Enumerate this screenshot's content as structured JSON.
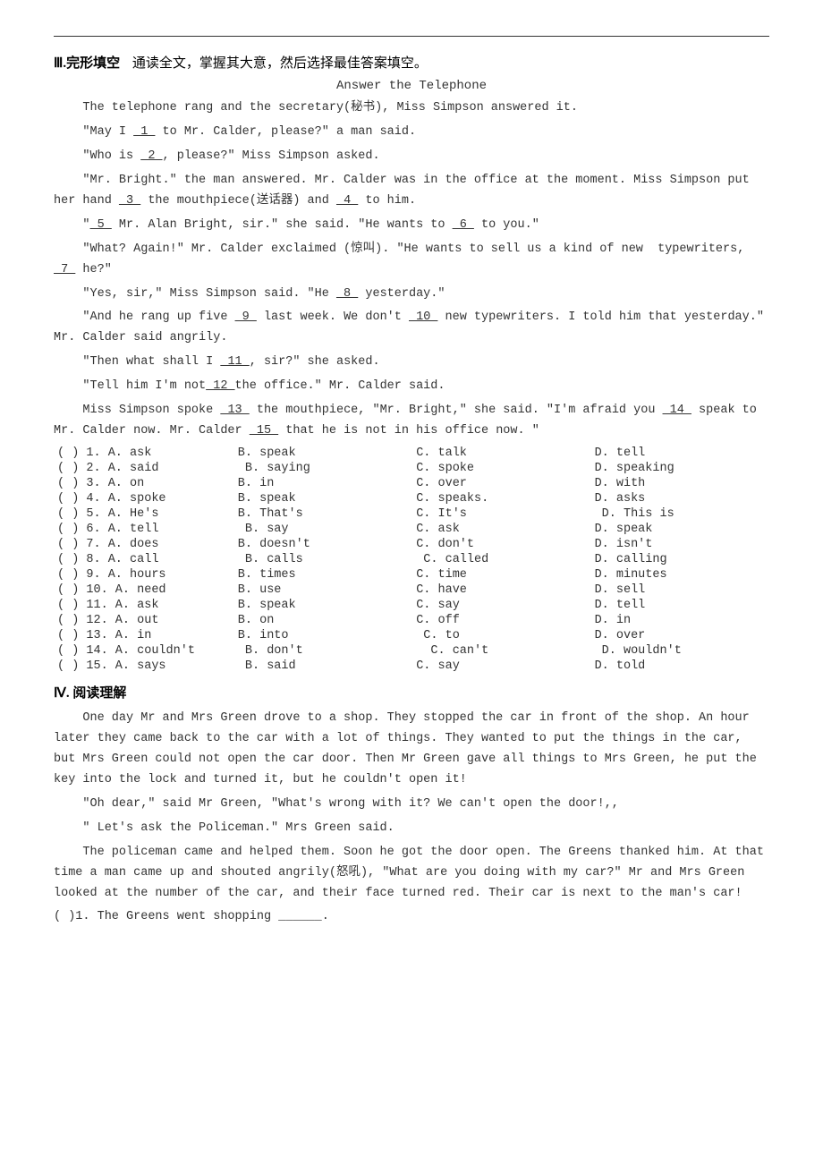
{
  "topBorder": true,
  "section3": {
    "header": "Ⅲ.完形填空",
    "instruction": "通读全文，掌握其大意，然后选择最佳答案填空。",
    "title": "Answer the Telephone",
    "passage": [
      "The telephone rang and the secretary(秘书), Miss Simpson answered it.",
      "\"May I __1__ to Mr. Calder, please?\" a man said.",
      "\"Who is __2__, please?\" Miss Simpson asked.",
      "\"Mr. Bright.\" the man answered. Mr. Calder was in the office at the moment. Miss Simpson put her hand __3__ the mouthpiece(送话器) and __4__ to him.",
      "\" __5__ Mr. Alan Bright, sir.\" she said. \"He wants to __6__ to you.\"",
      "\"What? Again!\" Mr. Calder exclaimed (惊叫). \"He wants to sell us a kind of new  typewriters, __7__ he?\"",
      "\"Yes, sir,\" Miss Simpson said. \"He __8__ yesterday.\"",
      "\"And he rang up five __9__ last week. We don't __10__ new typewriters. I told him that yesterday.\" Mr. Calder said angrily.",
      "\"Then what shall I __11__, sir?\" she asked.",
      "\"Tell him I'm not __12__ the office.\" Mr. Calder said.",
      "Miss Simpson spoke __13__ the mouthpiece, \"Mr. Bright,\" she said. \"I'm afraid you __14__ speak to Mr. Calder now. Mr. Calder __15__ that he is not in his office now.\""
    ],
    "options": [
      {
        "num": "( ) 1.",
        "A": "A. ask",
        "B": "B. speak",
        "C": "C. talk",
        "D": "D. tell"
      },
      {
        "num": "( ) 2.",
        "A": "A. said",
        "B": "B. saying",
        "C": "C. spoke",
        "D": "D. speaking"
      },
      {
        "num": "( ) 3.",
        "A": "A. on",
        "B": "B. in",
        "C": "C. over",
        "D": "D. with"
      },
      {
        "num": "( ) 4.",
        "A": "A. spoke",
        "B": "B. speak",
        "C": "C. speaks.",
        "D": "D. asks"
      },
      {
        "num": "( ) 5.",
        "A": "A. He's",
        "B": "B. That's",
        "C": "C. It's",
        "D": "D. This is"
      },
      {
        "num": "( ) 6.",
        "A": "A. tell",
        "B": "B. say",
        "C": "C. ask",
        "D": "D. speak"
      },
      {
        "num": "( ) 7.",
        "A": "A. does",
        "B": "B. doesn't",
        "C": "C. don't",
        "D": "D. isn't"
      },
      {
        "num": "( ) 8.",
        "A": "A. call",
        "B": "B. calls",
        "C": "C. called",
        "D": "D. calling"
      },
      {
        "num": "( ) 9.",
        "A": "A. hours",
        "B": "B. times",
        "C": "C. time",
        "D": "D. minutes"
      },
      {
        "num": "( ) 10.",
        "A": "A. need",
        "B": "B. use",
        "C": "C. have",
        "D": "D. sell"
      },
      {
        "num": "( ) 11.",
        "A": "A. ask",
        "B": "B. speak",
        "C": "C. say",
        "D": "D. tell"
      },
      {
        "num": "( ) 12.",
        "A": "A. out",
        "B": "B. on",
        "C": "C. off",
        "D": "D. in"
      },
      {
        "num": "( ) 13.",
        "A": "A. in",
        "B": "B. into",
        "C": "C. to",
        "D": "D. over"
      },
      {
        "num": "( ) 14.",
        "A": "A. couldn't",
        "B": "B. don't",
        "C": "C. can't",
        "D": "D. wouldn't"
      },
      {
        "num": "( ) 15.",
        "A": "A. says",
        "B": "B. said",
        "C": "C. say",
        "D": "D. told"
      }
    ]
  },
  "section4": {
    "header": "Ⅳ. 阅读理解",
    "passage": [
      "One day Mr and Mrs Green drove to a shop. They stopped the car in front of the shop. An hour later they came back to the car with a lot of things. They wanted to put the things in the car, but Mrs Green could not open the car door. Then Mr Green gave all things to Mrs Green, he put the key into the lock and turned it, but he couldn't open it!",
      "\"Oh dear,\" said Mr Green, \"What's wrong with it? We can't open the door!,,",
      "\" Let's ask the Policeman.\" Mrs Green said.",
      "The policeman came and helped them. Soon he got the door open. The Greens thanked him. At that time a man came up and shouted angrily(怒吼), \"What are you doing with my car?\" Mr and Mrs Green looked at the number of the car, and their face turned red. Their car is next to the man's car!"
    ],
    "question1": "( )1. The Greens went shopping ______."
  }
}
